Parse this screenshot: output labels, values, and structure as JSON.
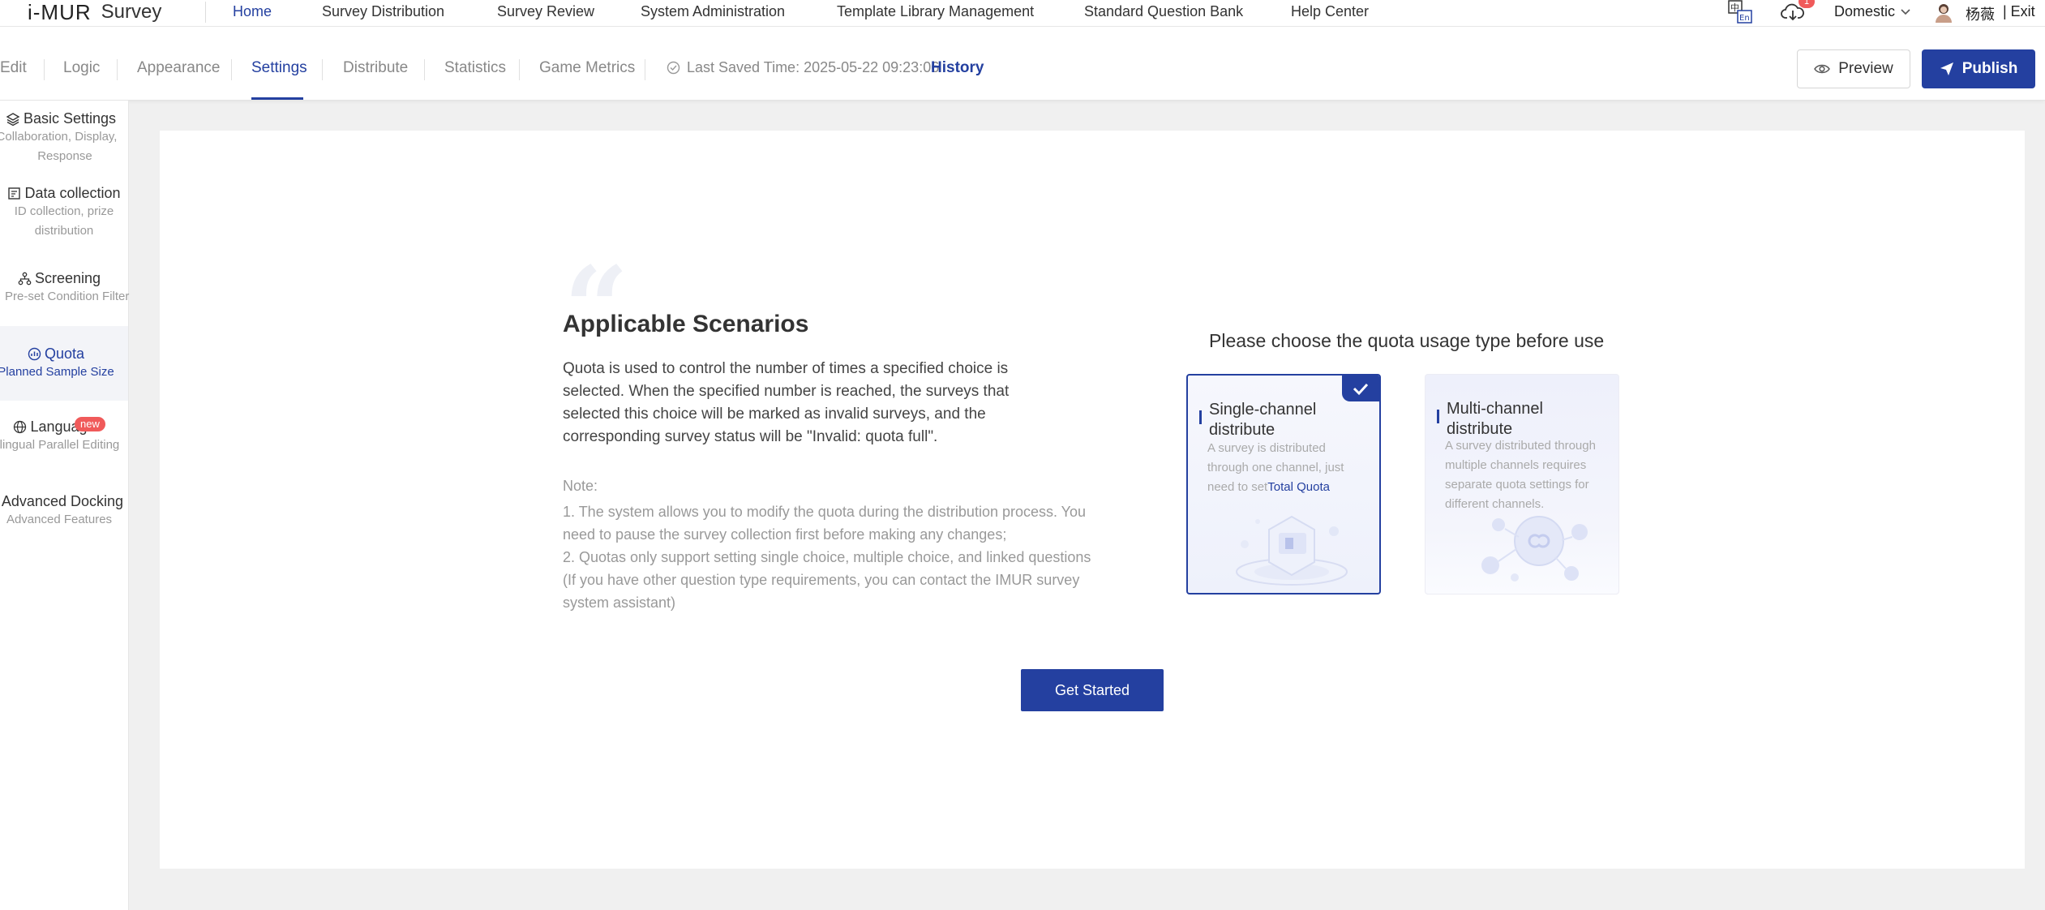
{
  "topnav": {
    "logo_mark": "i-MUR",
    "logo_text": "Survey",
    "items": [
      {
        "label": "Home",
        "active": true
      },
      {
        "label": "Survey Distribution",
        "active": false
      },
      {
        "label": "Survey Review",
        "active": false
      },
      {
        "label": "System Administration",
        "active": false
      },
      {
        "label": "Template Library Management",
        "active": false
      },
      {
        "label": "Standard Question Bank",
        "active": false
      },
      {
        "label": "Help Center",
        "active": false
      }
    ],
    "notification_count": "1",
    "region": "Domestic",
    "user_name": "杨薇",
    "exit_label": "| Exit"
  },
  "subbar": {
    "tabs": [
      {
        "label": "Edit"
      },
      {
        "label": "Logic"
      },
      {
        "label": "Appearance"
      },
      {
        "label": "Settings",
        "active": true
      },
      {
        "label": "Distribute"
      },
      {
        "label": "Statistics"
      },
      {
        "label": "Game Metrics"
      }
    ],
    "last_saved": "Last Saved Time: 2025-05-22 09:23:06",
    "history_label": "History",
    "preview_label": "Preview",
    "publish_label": "Publish"
  },
  "sidebar": {
    "items": [
      {
        "title": "Basic Settings",
        "sub1": "Collaboration, Display,",
        "sub2": "Response",
        "icon": "layers-icon"
      },
      {
        "title": "Data collection",
        "sub1": "ID collection, prize",
        "sub2": "distribution",
        "icon": "form-icon"
      },
      {
        "title": "Screening",
        "sub1": "Pre-set Condition Filter",
        "icon": "tree-icon"
      },
      {
        "title": "Quota",
        "sub1": "Planned Sample Size",
        "icon": "quota-icon",
        "active": true
      },
      {
        "title": "Language",
        "sub1": "Multilingual Parallel Editing",
        "icon": "globe-icon",
        "badge": "new"
      },
      {
        "title": "Advanced Docking",
        "sub1": "Advanced Features",
        "icon": "plug-icon"
      }
    ]
  },
  "main": {
    "title": "Applicable Scenarios",
    "description": "Quota is used to control the number of times a specified choice is selected. When the specified number is reached, the surveys that selected this choice will be marked as invalid surveys, and the corresponding survey status will be \"Invalid: quota full\".",
    "note_heading": "Note:",
    "note_lines": [
      "1. The system allows you to modify the quota during the distribution process. You",
      "need to pause the survey collection first before making any changes;",
      "2. Quotas only support setting single choice, multiple choice, and linked questions",
      "(If you have other question type requirements, you can contact the IMUR survey",
      "system assistant)"
    ],
    "choose_title": "Please choose the quota usage type before use",
    "options": {
      "single": {
        "title": "Single-channel distribute",
        "desc": "A survey is distributed through one channel, just need to set",
        "desc_highlight": "Total Quota",
        "selected": true
      },
      "multi": {
        "title": "Multi-channel distribute",
        "desc": "A survey distributed through multiple channels requires separate quota settings for different channels.",
        "selected": false
      }
    },
    "start_label": "Get Started"
  },
  "colors": {
    "primary": "#2440a0",
    "badge": "#f05a5a"
  }
}
